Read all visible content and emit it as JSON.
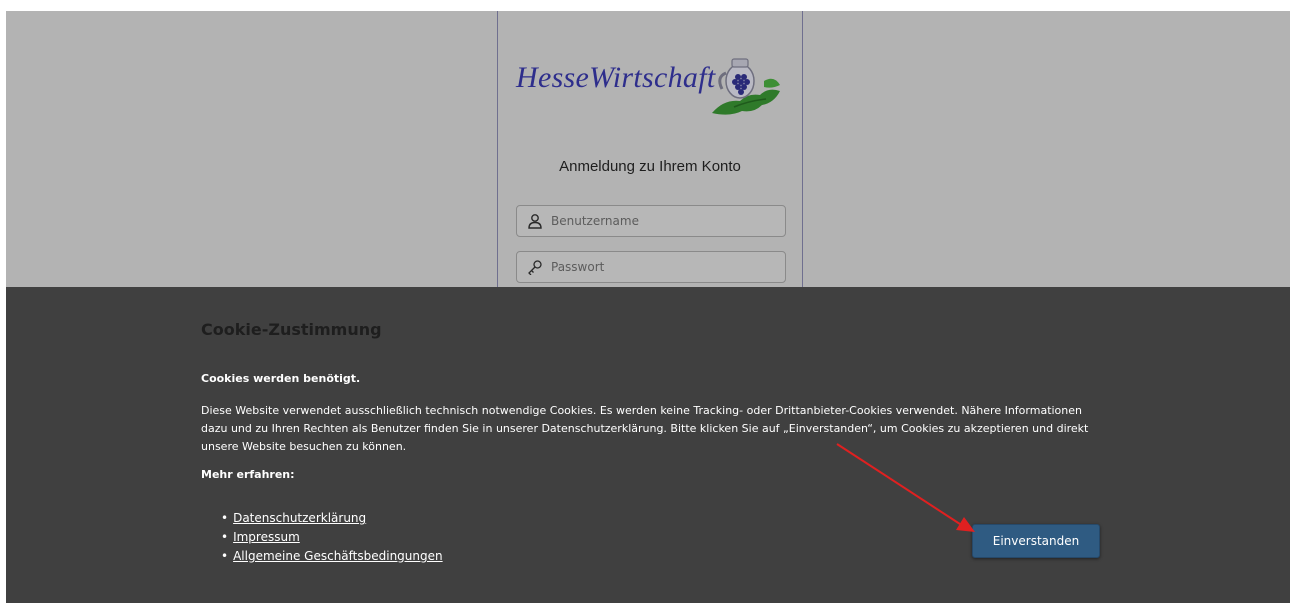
{
  "login": {
    "logo_text": "HesseWirtschaft",
    "title": "Anmeldung zu Ihrem Konto",
    "username_placeholder": "Benutzername",
    "password_placeholder": "Passwort"
  },
  "cookie": {
    "title": "Cookie-Zustimmung",
    "subtitle": "Cookies werden benötigt.",
    "body": "Diese Website verwendet ausschließlich technisch notwendige Cookies. Es werden keine Tracking- oder Drittanbieter-Cookies verwendet. Nähere Informationen dazu und zu Ihren Rechten als Benutzer finden Sie in unserer Datenschutzerklärung. Bitte klicken Sie auf „Einverstanden“, um Cookies zu akzeptieren und direkt unsere Website besuchen zu können.",
    "learn_more": "Mehr erfahren:",
    "links": [
      "Datenschutzerklärung",
      "Impressum",
      "Allgemeine Geschäftsbedingungen"
    ],
    "accept_label": "Einverstanden"
  },
  "colors": {
    "backdrop": "#b3b3b3",
    "banner": "#404040",
    "button": "#2f5b82",
    "logo": "#2e2e8c",
    "annotation_arrow": "#e02020"
  },
  "icons": {
    "username": "user-icon",
    "password": "key-icon"
  }
}
